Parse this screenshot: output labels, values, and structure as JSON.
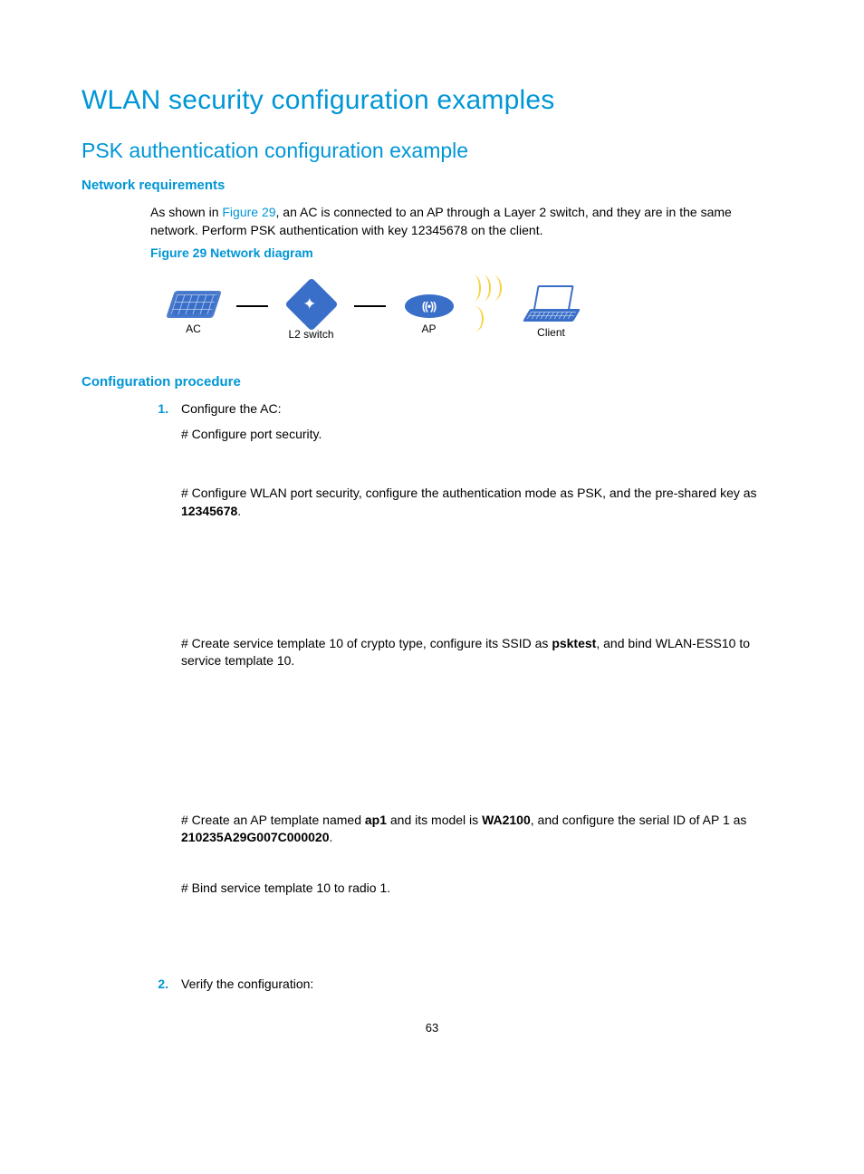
{
  "h1": "WLAN security configuration examples",
  "h2": "PSK authentication configuration example",
  "sec1": {
    "heading": "Network requirements",
    "intro_pre": "As shown in ",
    "intro_link": "Figure 29",
    "intro_post": ", an AC is connected to an AP through a Layer 2 switch, and they are in the same network. Perform PSK authentication with key 12345678 on the client.",
    "fig_caption": "Figure 29 Network diagram",
    "labels": {
      "ac": "AC",
      "sw": "L2 switch",
      "ap": "AP",
      "client": "Client"
    }
  },
  "sec2": {
    "heading": "Configuration procedure",
    "step1_title": "Configure the AC:",
    "s1a": "# Configure port security.",
    "s1b_pre": "# Configure WLAN port security, configure the authentication mode as PSK, and the pre-shared key as ",
    "s1b_bold": "12345678",
    "s1b_post": ".",
    "s1c_pre": "# Create service template 10 of crypto type, configure its SSID as ",
    "s1c_bold": "psktest",
    "s1c_post": ", and bind WLAN-ESS10 to service template 10.",
    "s1d_pre": "# Create an AP template named ",
    "s1d_b1": "ap1",
    "s1d_mid1": " and its model is ",
    "s1d_b2": "WA2100",
    "s1d_mid2": ", and configure the serial ID of AP 1 as ",
    "s1d_b3": "210235A29G007C000020",
    "s1d_post": ".",
    "s1e": "# Bind service template 10 to radio 1.",
    "step2_title": "Verify the configuration:"
  },
  "page": "63"
}
